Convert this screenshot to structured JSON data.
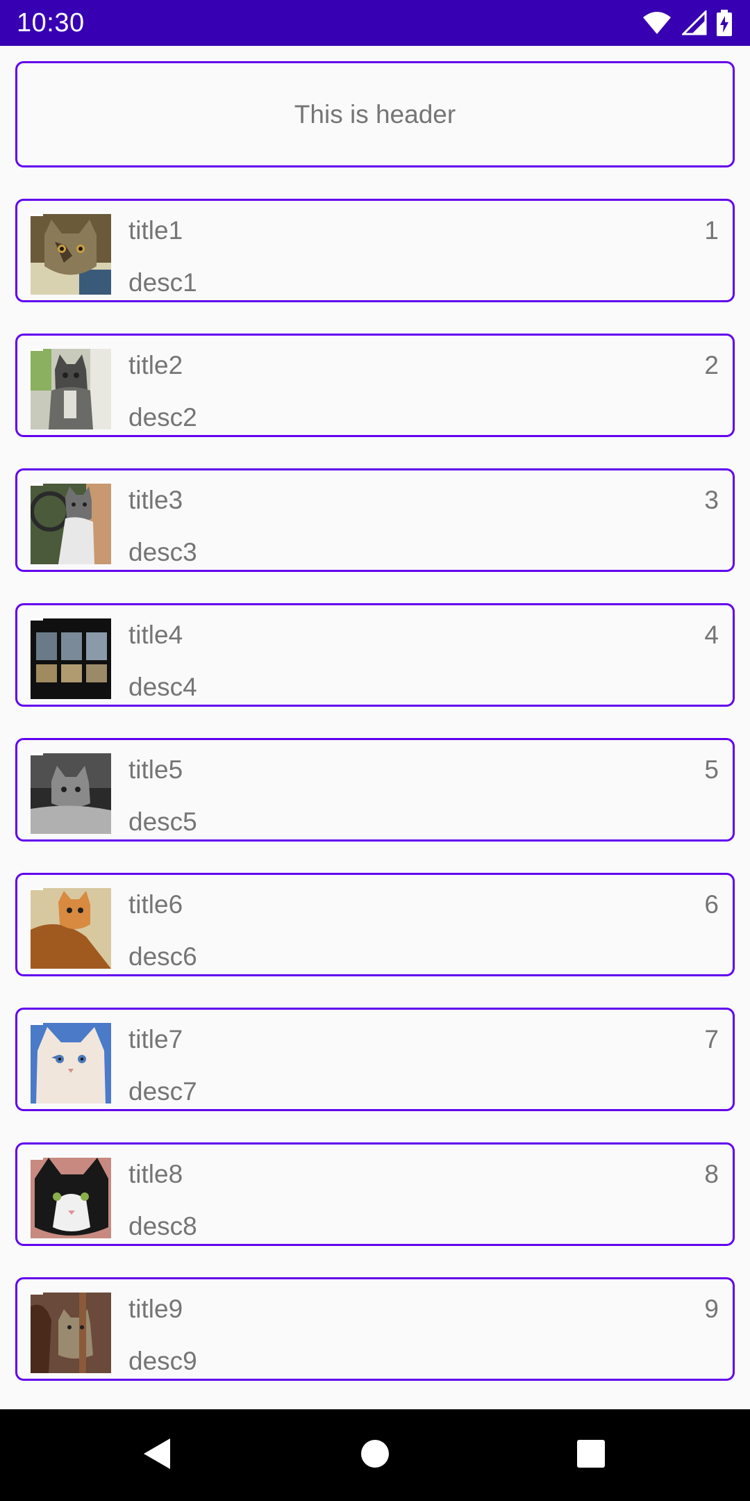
{
  "status_bar": {
    "time": "10:30",
    "icons": [
      "wifi-icon",
      "signal-icon",
      "battery-charging-icon"
    ]
  },
  "header": {
    "text": "This is header"
  },
  "items": [
    {
      "title": "title1",
      "desc": "desc1",
      "number": "1",
      "thumb": "cat-photo-1"
    },
    {
      "title": "title2",
      "desc": "desc2",
      "number": "2",
      "thumb": "cat-photo-2"
    },
    {
      "title": "title3",
      "desc": "desc3",
      "number": "3",
      "thumb": "cat-photo-3"
    },
    {
      "title": "title4",
      "desc": "desc4",
      "number": "4",
      "thumb": "cat-photo-4"
    },
    {
      "title": "title5",
      "desc": "desc5",
      "number": "5",
      "thumb": "cat-photo-5"
    },
    {
      "title": "title6",
      "desc": "desc6",
      "number": "6",
      "thumb": "cat-photo-6"
    },
    {
      "title": "title7",
      "desc": "desc7",
      "number": "7",
      "thumb": "cat-photo-7"
    },
    {
      "title": "title8",
      "desc": "desc8",
      "number": "8",
      "thumb": "cat-photo-8"
    },
    {
      "title": "title9",
      "desc": "desc9",
      "number": "9",
      "thumb": "cat-photo-9"
    }
  ],
  "nav_bar": {
    "buttons": [
      "back-icon",
      "home-icon",
      "recents-icon"
    ]
  },
  "colors": {
    "status_bar": "#3700b3",
    "card_border": "#6200ee",
    "text": "#757575",
    "background": "#fafafa",
    "nav_bar": "#000000"
  }
}
